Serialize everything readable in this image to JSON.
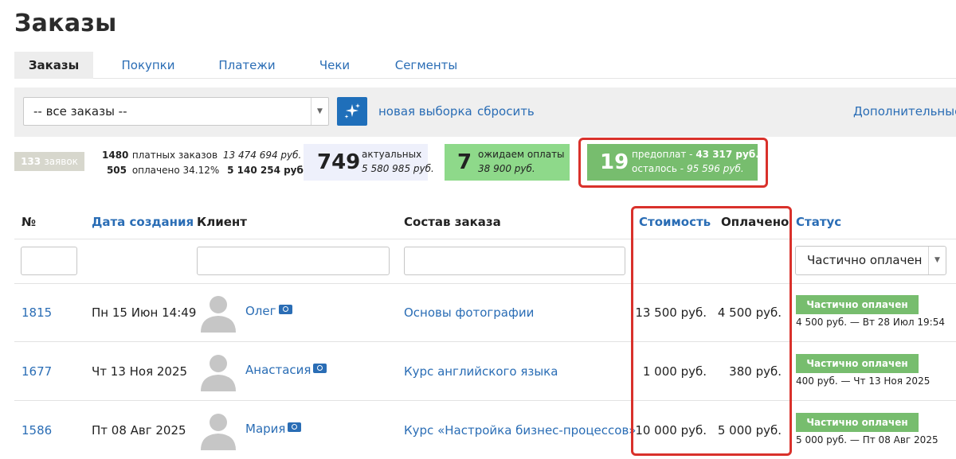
{
  "page_title": "Заказы",
  "tabs": [
    {
      "label": "Заказы",
      "active": true
    },
    {
      "label": "Покупки",
      "active": false
    },
    {
      "label": "Платежи",
      "active": false
    },
    {
      "label": "Чеки",
      "active": false
    },
    {
      "label": "Сегменты",
      "active": false
    }
  ],
  "toolbar": {
    "segment_value": "-- все заказы --",
    "new_selection": "новая выборка",
    "reset": "сбросить",
    "additional": "Дополнительные"
  },
  "summary": {
    "requests_count": "133",
    "requests_label": "заявок",
    "paid_orders_count": "1480",
    "paid_orders_label": "платных заказов",
    "paid_orders_sum": "13 474 694 руб.",
    "paid_count": "505",
    "paid_label": "оплачено 34.12%",
    "paid_sum": "5 140 254 руб.",
    "actual_count": "749",
    "actual_label": "актуальных",
    "actual_sum": "5 580 985 руб.",
    "waiting_count": "7",
    "waiting_label": "ожидаем оплаты",
    "waiting_sum": "38 900 руб.",
    "prepay_count": "19",
    "prepay_label": "предоплат - ",
    "prepay_sum": "43 317 руб.",
    "remaining_label": "осталось - ",
    "remaining_sum": "95 596 руб."
  },
  "table": {
    "headers": {
      "num": "№",
      "created": "Дата создания",
      "client": "Клиент",
      "composition": "Состав заказа",
      "cost": "Стоимость",
      "paid": "Оплачено",
      "status": "Статус"
    },
    "status_filter": "Частично оплачен",
    "rows": [
      {
        "id": "1815",
        "date": "Пн 15 Июн 14:49",
        "client": "Олег",
        "product": "Основы фотографии",
        "cost": "13 500 руб.",
        "paid": "4 500 руб.",
        "status": "Частично оплачен",
        "status_note": "4 500 руб. — Вт 28 Июл 19:54"
      },
      {
        "id": "1677",
        "date": "Чт 13 Ноя 2025",
        "client": "Анастасия",
        "product": "Курс английского языка",
        "cost": "1 000 руб.",
        "paid": "380 руб.",
        "status": "Частично оплачен",
        "status_note": "400 руб. — Чт 13 Ноя 2025"
      },
      {
        "id": "1586",
        "date": "Пт 08 Авг 2025",
        "client": "Мария",
        "product": "Курс «Настройка бизнес-процессов»",
        "cost": "10 000 руб.",
        "paid": "5 000 руб.",
        "status": "Частично оплачен",
        "status_note": "5 000 руб. — Пт 08 Авг 2025"
      }
    ]
  },
  "colors": {
    "link": "#2a6db5",
    "accent_button": "#1f6fba",
    "waiting_card": "#8ed98a",
    "prepay_card": "#77bd6e",
    "status_badge": "#77bd6e",
    "highlight": "#d9312b"
  }
}
